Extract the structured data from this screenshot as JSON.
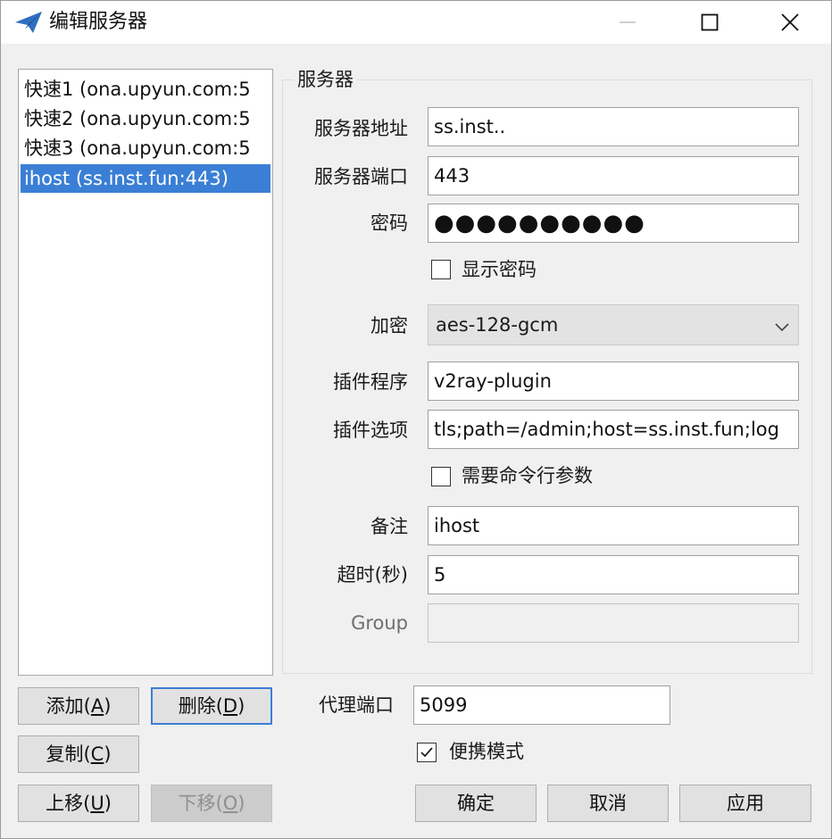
{
  "window": {
    "title": "编辑服务器"
  },
  "server_list": {
    "items": [
      {
        "label": "快速1 (ona.upyun.com:5",
        "selected": false
      },
      {
        "label": "快速2 (ona.upyun.com:5",
        "selected": false
      },
      {
        "label": "快速3 (ona.upyun.com:5",
        "selected": false
      },
      {
        "label": "ihost (ss.inst.fun:443)",
        "selected": true
      }
    ]
  },
  "server_group": {
    "title": "服务器",
    "address_label": "服务器地址",
    "address_value": "ss.inst..",
    "port_label": "服务器端口",
    "port_value": "443",
    "password_label": "密码",
    "password_masked": "●●●●●●●●●●",
    "show_password_label": "显示密码",
    "show_password_checked": false,
    "encryption_label": "加密",
    "encryption_value": "aes-128-gcm",
    "plugin_label": "插件程序",
    "plugin_value": "v2ray-plugin",
    "plugin_options_label": "插件选项",
    "plugin_options_value": "tls;path=/admin;host=ss.inst.fun;log",
    "need_args_label": "需要命令行参数",
    "need_args_checked": false,
    "remarks_label": "备注",
    "remarks_value": "ihost",
    "timeout_label": "超时(秒)",
    "timeout_value": "5",
    "group_label": "Group",
    "group_value": ""
  },
  "list_buttons": {
    "add_text": "添加(",
    "add_key": "A",
    "delete_text": "删除(",
    "delete_key": "D",
    "copy_text": "复制(",
    "copy_key": "C",
    "move_up_text": "上移(",
    "move_up_key": "U",
    "move_down_text": "下移(",
    "move_down_key": "O",
    "close_paren": ")"
  },
  "bottom": {
    "proxy_port_label": "代理端口",
    "proxy_port_value": "5099",
    "portable_mode_label": "便携模式",
    "portable_mode_checked": true,
    "ok_label": "确定",
    "cancel_label": "取消",
    "apply_label": "应用"
  },
  "colors": {
    "selection": "#3a7fd5",
    "app_icon": "#2f6fc0"
  }
}
